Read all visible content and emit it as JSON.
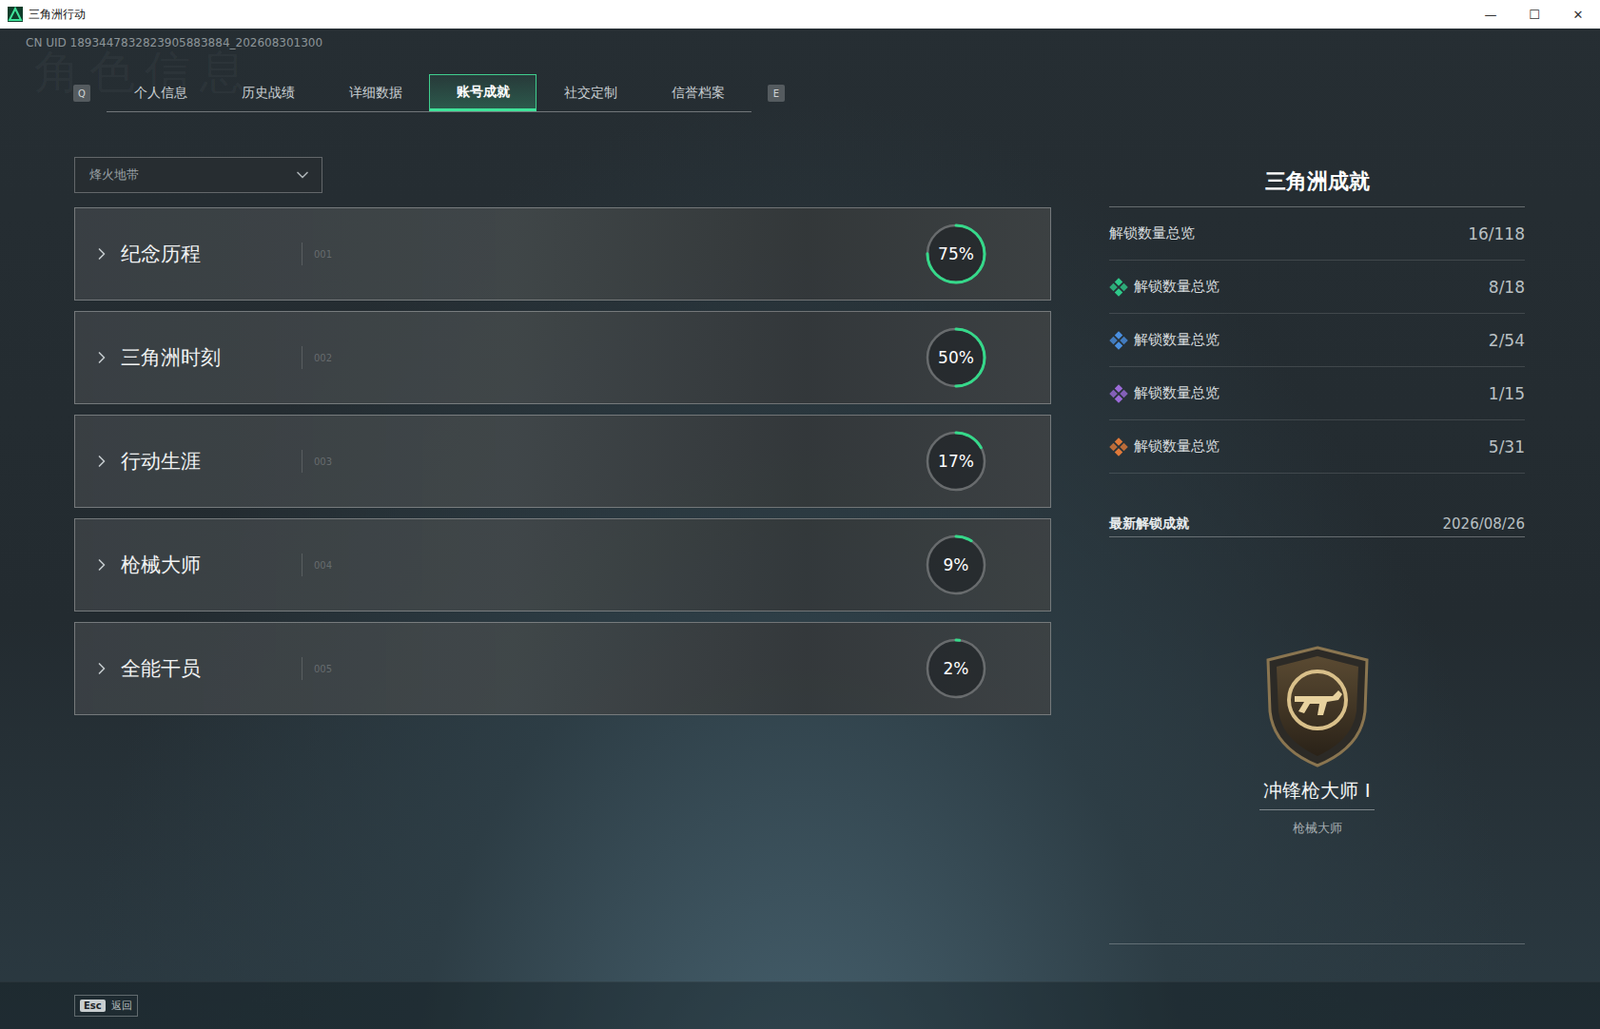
{
  "window": {
    "title": "三角洲行动",
    "controls": [
      "—",
      "☐",
      "✕"
    ]
  },
  "uid": "CN UID 1893447832823905883884_202608301300",
  "watermark": "角色信息",
  "tabs": {
    "prev_key": "Q",
    "next_key": "E",
    "items": [
      {
        "label": "个人信息",
        "selected": false
      },
      {
        "label": "历史战绩",
        "selected": false
      },
      {
        "label": "详细数据",
        "selected": false
      },
      {
        "label": "账号成就",
        "selected": true
      },
      {
        "label": "社交定制",
        "selected": false
      },
      {
        "label": "信誉档案",
        "selected": false
      }
    ]
  },
  "mode_select": {
    "value": "烽火地带",
    "expanded": false
  },
  "categories": [
    {
      "title": "纪念历程",
      "index": "001",
      "percent": "75%",
      "level": 0.75
    },
    {
      "title": "三角洲时刻",
      "index": "002",
      "percent": "50%",
      "level": 0.5
    },
    {
      "title": "行动生涯",
      "index": "003",
      "percent": "17%",
      "level": 0.17
    },
    {
      "title": "枪械大师",
      "index": "004",
      "percent": "9%",
      "level": 0.09
    },
    {
      "title": "全能干员",
      "index": "005",
      "percent": "2%",
      "level": 0.02
    }
  ],
  "summary": {
    "title": "三角洲成就",
    "total": {
      "label": "解锁数量总览",
      "count": "16/118"
    },
    "tiers": [
      {
        "label": "解锁数量总览",
        "count": "8/18",
        "color": "#2fc98a"
      },
      {
        "label": "解锁数量总览",
        "count": "2/54",
        "color": "#4a8fe0"
      },
      {
        "label": "解锁数量总览",
        "count": "1/15",
        "color": "#9b6bd8"
      },
      {
        "label": "解锁数量总览",
        "count": "5/31",
        "color": "#e07a3a"
      }
    ]
  },
  "latest": {
    "heading": "最新解锁成就",
    "date": "2026/08/26",
    "name": "冲锋枪大师 I",
    "category": "枪械大师"
  },
  "footer": {
    "key": "Esc",
    "label": "返回"
  }
}
